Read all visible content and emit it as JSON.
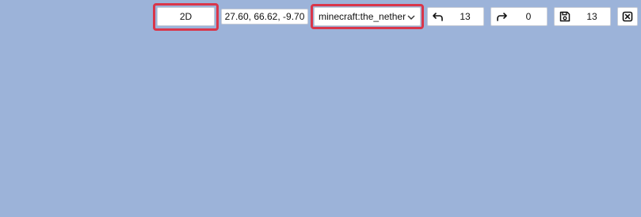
{
  "colors": {
    "viewport_background": "#9cb3d9",
    "highlight": "#d9364a"
  },
  "toolbar": {
    "view_mode": "2D",
    "coordinates": "27.60, 66.62, -9.70",
    "dimension_select": {
      "selected": "minecraft:the_nether",
      "icon": "chevron-down-icon"
    },
    "undo": {
      "icon": "undo-icon",
      "count": "13"
    },
    "redo": {
      "icon": "redo-icon",
      "count": "0"
    },
    "save": {
      "icon": "save-icon",
      "count": "13"
    },
    "close": {
      "icon": "close-box-icon"
    }
  }
}
